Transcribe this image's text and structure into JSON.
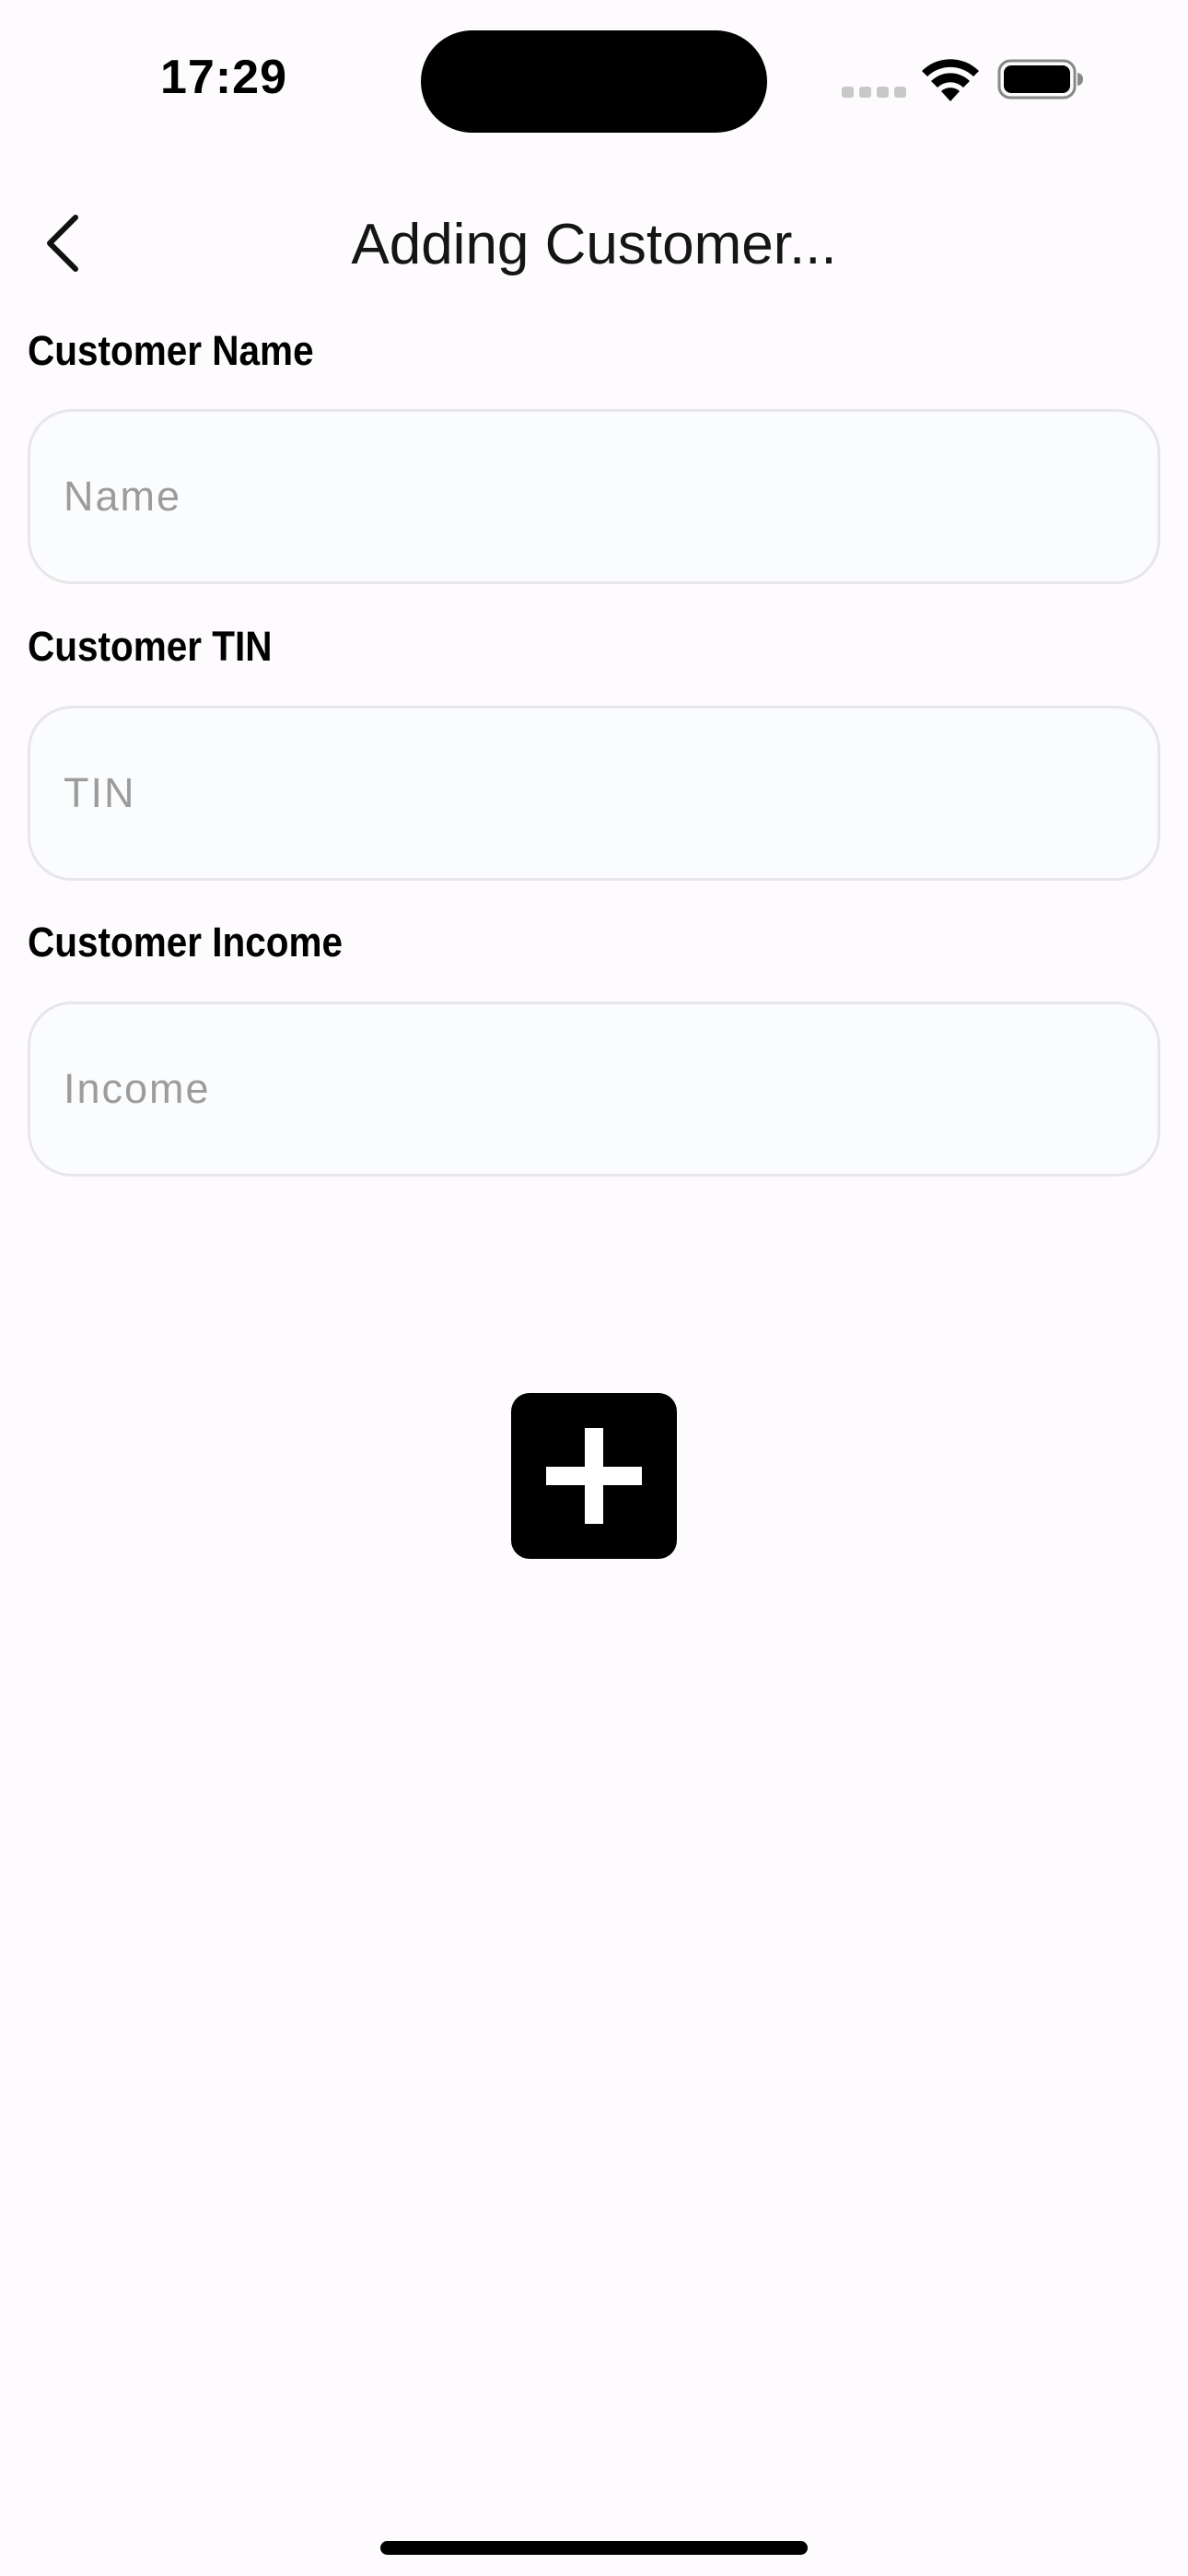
{
  "status_bar": {
    "time": "17:29",
    "icons": [
      "signal-icon",
      "wifi-icon",
      "battery-icon"
    ]
  },
  "nav": {
    "title": "Adding Customer...",
    "back_icon": "chevron-left-icon"
  },
  "form": {
    "name": {
      "label": "Customer Name",
      "placeholder": "Name",
      "value": ""
    },
    "tin": {
      "label": "Customer TIN",
      "placeholder": "TIN",
      "value": ""
    },
    "income": {
      "label": "Customer Income",
      "placeholder": "Income",
      "value": ""
    }
  },
  "actions": {
    "add_icon": "plus-icon"
  },
  "colors": {
    "background": "#fdfbfd",
    "input_background": "#fbfcfd",
    "input_border": "#e8e6e8",
    "placeholder": "#9c9c9c",
    "button": "#000000"
  }
}
